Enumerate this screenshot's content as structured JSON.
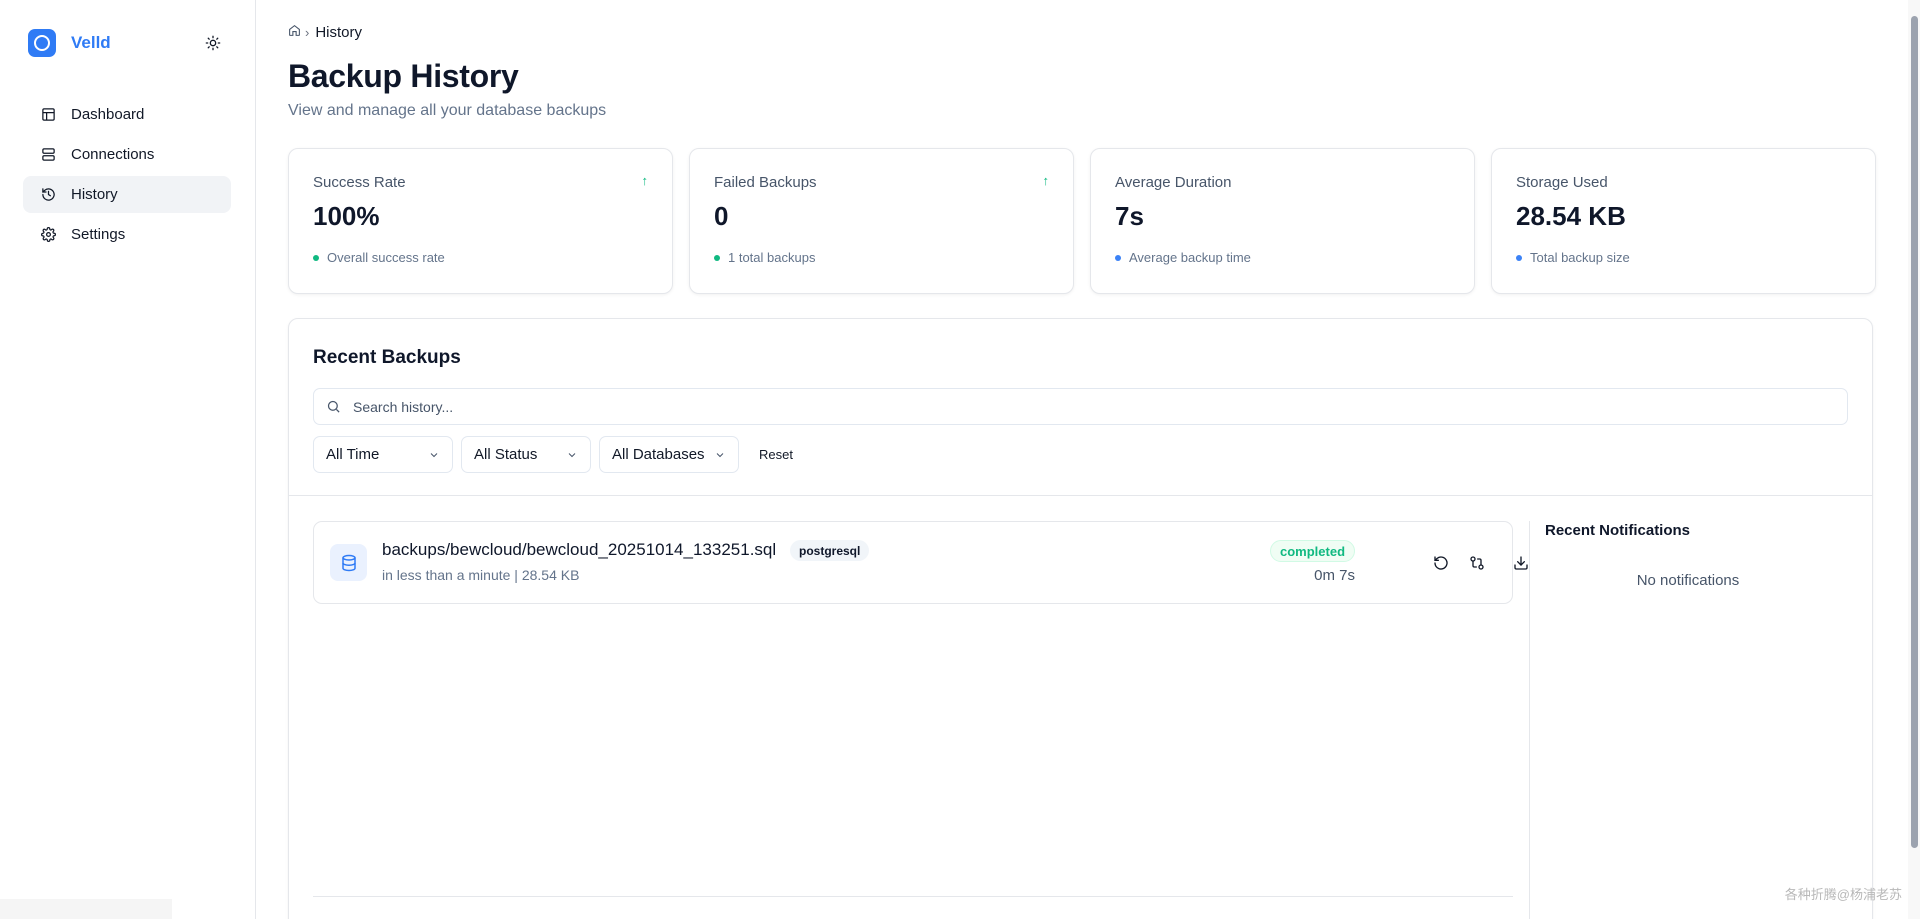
{
  "app": {
    "name": "Velld"
  },
  "sidebar": {
    "items": [
      {
        "label": "Dashboard",
        "icon": "layout-icon"
      },
      {
        "label": "Connections",
        "icon": "server-icon"
      },
      {
        "label": "History",
        "icon": "history-icon",
        "active": true
      },
      {
        "label": "Settings",
        "icon": "gear-icon"
      }
    ]
  },
  "breadcrumb": {
    "current": "History"
  },
  "header": {
    "title": "Backup History",
    "subtitle": "View and manage all your database backups"
  },
  "stats": [
    {
      "label": "Success Rate",
      "value": "100%",
      "note": "Overall success rate",
      "dot_color": "#10b981",
      "trend": "up"
    },
    {
      "label": "Failed Backups",
      "value": "0",
      "note": "1 total backups",
      "dot_color": "#10b981",
      "trend": "up"
    },
    {
      "label": "Average Duration",
      "value": "7s",
      "note": "Average backup time",
      "dot_color": "#3b82f6"
    },
    {
      "label": "Storage Used",
      "value": "28.54 KB",
      "note": "Total backup size",
      "dot_color": "#3b82f6"
    }
  ],
  "recent": {
    "title": "Recent Backups",
    "search_placeholder": "Search history...",
    "filters": {
      "time": "All Time",
      "status": "All Status",
      "databases": "All Databases",
      "reset": "Reset"
    },
    "backups": [
      {
        "path": "backups/bewcloud/bewcloud_20251014_133251.sql",
        "db_type": "postgresql",
        "meta": "in less than a minute | 28.54 KB",
        "status": "completed",
        "duration": "0m 7s"
      }
    ]
  },
  "notifications": {
    "title": "Recent Notifications",
    "empty": "No notifications"
  },
  "watermark": "各种折腾@杨浦老苏",
  "colors": {
    "accent": "#2f7bf5",
    "success": "#10b981",
    "info": "#3b82f6"
  }
}
